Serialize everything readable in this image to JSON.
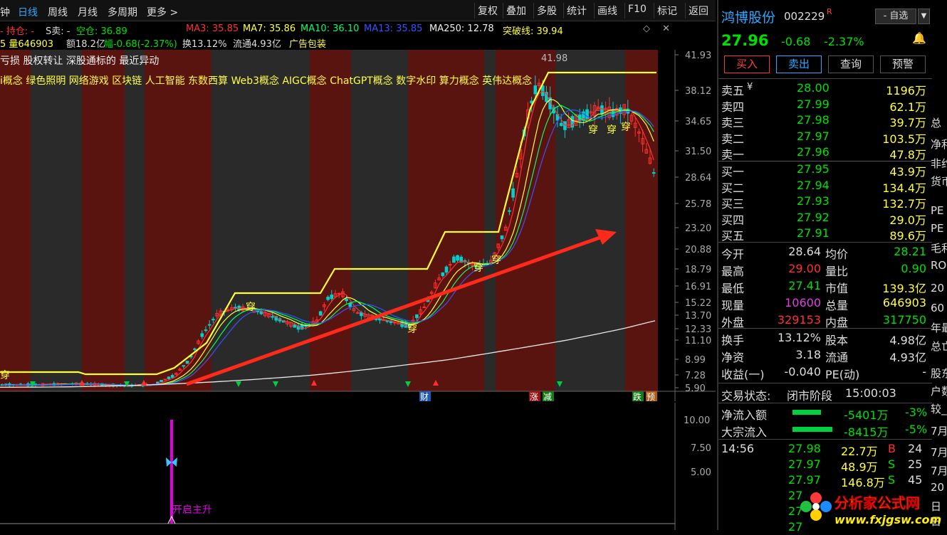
{
  "toolbar": {
    "left": [
      "钟",
      "日线",
      "周线",
      "月线",
      "多周期",
      "更多 >"
    ],
    "right": [
      "复权",
      "叠加",
      "多股",
      "统计",
      "画线",
      "F10",
      "标记",
      "返回"
    ]
  },
  "header": {
    "row1": {
      "hold_prefix": "- 持仓: -",
      "sell": "S卖: -",
      "cash": "空仓: 36.89",
      "ma3": "MA3: 35.85",
      "ma7": "MA7: 35.86",
      "ma10": "MA10: 36.10",
      "ma13": "MA13: 35.85",
      "ma250": "MA250: 12.78",
      "breakout": "突破线: 39.94"
    },
    "row2": {
      "vol": "5 量646903",
      "amount": "额18.2亿",
      "change": "幅-0.68(-2.37%)",
      "turnover": "换13.12%",
      "float": "流通4.93亿",
      "tags": "广告包装"
    }
  },
  "chart": {
    "tagline1": "亏损 股权转让 深股通标的 最近异动",
    "tagline2": "i概念 绿色照明 网络游戏 区块链 人工智能 东数西算 Web3概念 AIGC概念 ChatGPT概念 数字水印 算力概念 英伟达概念",
    "peak_label": "41.98",
    "yaxis": [
      "41.93",
      "38.12",
      "34.65",
      "31.50",
      "28.64",
      "25.78",
      "23.20",
      "20.88",
      "18.79",
      "16.91",
      "15.22",
      "13.70",
      "12.33",
      "11.10",
      "8.99",
      "7.28",
      "5.90"
    ],
    "chuan_labels": [
      "穿",
      "穿",
      "穿",
      "穿",
      "穿",
      "穿",
      "穿",
      "穿"
    ],
    "markers": {
      "cai": "财",
      "zhang": "涨",
      "jian": "减",
      "die": "跌",
      "yu": "预"
    },
    "colors": {
      "bull": "#ff3030",
      "bear": "#00d0d0",
      "band": "#5a1410",
      "band_gray": "#484848",
      "breakout": "#ffff33"
    }
  },
  "subchart": {
    "yaxis": [
      "10.00",
      "7.50",
      "5.00"
    ],
    "signal_label": "开启主升"
  },
  "stock": {
    "name": "鸿博股份",
    "code": "002229",
    "r_badge": "R",
    "watch_btn": "- 自选",
    "price": "27.96",
    "change": "-0.68",
    "change_pct": "-2.37%"
  },
  "actions": [
    "买入",
    "卖出",
    "查询",
    "预警"
  ],
  "orderbook": {
    "asks": [
      {
        "label": "卖五",
        "price": "28.00",
        "vol": "1196万"
      },
      {
        "label": "卖四",
        "price": "27.99",
        "vol": "62.1万"
      },
      {
        "label": "卖三",
        "price": "27.98",
        "vol": "39.7万"
      },
      {
        "label": "卖二",
        "price": "27.97",
        "vol": "103.5万"
      },
      {
        "label": "卖一",
        "price": "27.96",
        "vol": "47.8万"
      }
    ],
    "bids": [
      {
        "label": "买一",
        "price": "27.95",
        "vol": "43.9万"
      },
      {
        "label": "买二",
        "price": "27.94",
        "vol": "134.4万"
      },
      {
        "label": "买三",
        "price": "27.93",
        "vol": "132.7万"
      },
      {
        "label": "买四",
        "price": "27.92",
        "vol": "29.0万"
      },
      {
        "label": "买五",
        "price": "27.91",
        "vol": "89.6万"
      }
    ]
  },
  "stats": [
    {
      "l1": "今开",
      "v1": "28.64",
      "l2": "均价",
      "v2": "28.21"
    },
    {
      "l1": "最高",
      "v1": "29.00",
      "l2": "量比",
      "v2": "0.90"
    },
    {
      "l1": "最低",
      "v1": "27.41",
      "l2": "市值",
      "v2": "139.3亿"
    },
    {
      "l1": "现量",
      "v1": "10600",
      "l2": "总量",
      "v2": "646903"
    },
    {
      "l1": "外盘",
      "v1": "329153",
      "l2": "内盘",
      "v2": "317750"
    }
  ],
  "stats2": [
    {
      "l1": "换手",
      "v1": "13.12%",
      "l2": "股本",
      "v2": "4.98亿"
    },
    {
      "l1": "净资",
      "v1": "3.18",
      "l2": "流通",
      "v2": "4.93亿"
    },
    {
      "l1": "收益(一)",
      "v1": "-0.040",
      "l2": "PE(动)",
      "v2": "-"
    }
  ],
  "trade_status": {
    "label": "交易状态:",
    "value": "闭市阶段",
    "time": "15:00:03"
  },
  "flows": [
    {
      "label": "净流入额",
      "value": "-5401万",
      "pct": "-3%"
    },
    {
      "label": "大宗流入",
      "value": "-8415万",
      "pct": "-5%"
    }
  ],
  "ticks": [
    {
      "time": "14:56",
      "price": "27.98",
      "vol": "22.7万",
      "side": "B",
      "num": "24"
    },
    {
      "time": "",
      "price": "27.97",
      "vol": "48.9万",
      "side": "S",
      "num": "25"
    },
    {
      "time": "",
      "price": "27.97",
      "vol": "146.8万",
      "side": "S",
      "num": "45"
    },
    {
      "time": "",
      "price": "27",
      "vol": "",
      "side": "",
      "num": ""
    },
    {
      "time": "",
      "price": "27",
      "vol": "",
      "side": "",
      "num": ""
    },
    {
      "time": "",
      "price": "27",
      "vol": "",
      "side": "",
      "num": ""
    }
  ],
  "edge_text": [
    "总",
    "净利",
    "非约",
    "货币",
    "PE",
    "PE",
    "毛利",
    "RO",
    "20",
    "60",
    "年最",
    "总亡",
    "股东",
    "户数",
    "较_",
    "7月",
    "7月",
    "7月",
    "20",
    "日",
    "日"
  ],
  "watermark": {
    "title": "分析家公式网",
    "url": "www.fxjgsw.com"
  }
}
